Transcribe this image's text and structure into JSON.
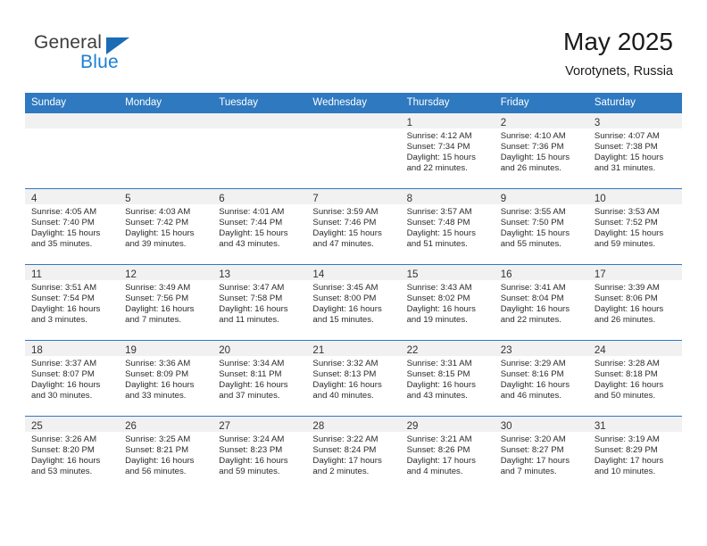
{
  "brand": {
    "line1": "General",
    "line2": "Blue",
    "triangle_color": "#1b6cb5",
    "blue_text_color": "#1b7fd4"
  },
  "header": {
    "title": "May 2025",
    "subtitle": "Vorotynets, Russia"
  },
  "theme": {
    "header_row_bg": "#2f79c0",
    "header_row_text": "#ffffff",
    "day_band_bg": "#f1f1f1",
    "row_divider": "#2f79c0"
  },
  "weekday_headers": [
    "Sunday",
    "Monday",
    "Tuesday",
    "Wednesday",
    "Thursday",
    "Friday",
    "Saturday"
  ],
  "labels": {
    "sunrise_prefix": "Sunrise:",
    "sunset_prefix": "Sunset:",
    "daylight_prefix": "Daylight:"
  },
  "weeks": [
    [
      {
        "day": "",
        "empty": true
      },
      {
        "day": "",
        "empty": true
      },
      {
        "day": "",
        "empty": true
      },
      {
        "day": "",
        "empty": true
      },
      {
        "day": "1",
        "sunrise": "Sunrise: 4:12 AM",
        "sunset": "Sunset: 7:34 PM",
        "daylight_line1": "Daylight: 15 hours",
        "daylight_line2": "and 22 minutes."
      },
      {
        "day": "2",
        "sunrise": "Sunrise: 4:10 AM",
        "sunset": "Sunset: 7:36 PM",
        "daylight_line1": "Daylight: 15 hours",
        "daylight_line2": "and 26 minutes."
      },
      {
        "day": "3",
        "sunrise": "Sunrise: 4:07 AM",
        "sunset": "Sunset: 7:38 PM",
        "daylight_line1": "Daylight: 15 hours",
        "daylight_line2": "and 31 minutes."
      }
    ],
    [
      {
        "day": "4",
        "sunrise": "Sunrise: 4:05 AM",
        "sunset": "Sunset: 7:40 PM",
        "daylight_line1": "Daylight: 15 hours",
        "daylight_line2": "and 35 minutes."
      },
      {
        "day": "5",
        "sunrise": "Sunrise: 4:03 AM",
        "sunset": "Sunset: 7:42 PM",
        "daylight_line1": "Daylight: 15 hours",
        "daylight_line2": "and 39 minutes."
      },
      {
        "day": "6",
        "sunrise": "Sunrise: 4:01 AM",
        "sunset": "Sunset: 7:44 PM",
        "daylight_line1": "Daylight: 15 hours",
        "daylight_line2": "and 43 minutes."
      },
      {
        "day": "7",
        "sunrise": "Sunrise: 3:59 AM",
        "sunset": "Sunset: 7:46 PM",
        "daylight_line1": "Daylight: 15 hours",
        "daylight_line2": "and 47 minutes."
      },
      {
        "day": "8",
        "sunrise": "Sunrise: 3:57 AM",
        "sunset": "Sunset: 7:48 PM",
        "daylight_line1": "Daylight: 15 hours",
        "daylight_line2": "and 51 minutes."
      },
      {
        "day": "9",
        "sunrise": "Sunrise: 3:55 AM",
        "sunset": "Sunset: 7:50 PM",
        "daylight_line1": "Daylight: 15 hours",
        "daylight_line2": "and 55 minutes."
      },
      {
        "day": "10",
        "sunrise": "Sunrise: 3:53 AM",
        "sunset": "Sunset: 7:52 PM",
        "daylight_line1": "Daylight: 15 hours",
        "daylight_line2": "and 59 minutes."
      }
    ],
    [
      {
        "day": "11",
        "sunrise": "Sunrise: 3:51 AM",
        "sunset": "Sunset: 7:54 PM",
        "daylight_line1": "Daylight: 16 hours",
        "daylight_line2": "and 3 minutes."
      },
      {
        "day": "12",
        "sunrise": "Sunrise: 3:49 AM",
        "sunset": "Sunset: 7:56 PM",
        "daylight_line1": "Daylight: 16 hours",
        "daylight_line2": "and 7 minutes."
      },
      {
        "day": "13",
        "sunrise": "Sunrise: 3:47 AM",
        "sunset": "Sunset: 7:58 PM",
        "daylight_line1": "Daylight: 16 hours",
        "daylight_line2": "and 11 minutes."
      },
      {
        "day": "14",
        "sunrise": "Sunrise: 3:45 AM",
        "sunset": "Sunset: 8:00 PM",
        "daylight_line1": "Daylight: 16 hours",
        "daylight_line2": "and 15 minutes."
      },
      {
        "day": "15",
        "sunrise": "Sunrise: 3:43 AM",
        "sunset": "Sunset: 8:02 PM",
        "daylight_line1": "Daylight: 16 hours",
        "daylight_line2": "and 19 minutes."
      },
      {
        "day": "16",
        "sunrise": "Sunrise: 3:41 AM",
        "sunset": "Sunset: 8:04 PM",
        "daylight_line1": "Daylight: 16 hours",
        "daylight_line2": "and 22 minutes."
      },
      {
        "day": "17",
        "sunrise": "Sunrise: 3:39 AM",
        "sunset": "Sunset: 8:06 PM",
        "daylight_line1": "Daylight: 16 hours",
        "daylight_line2": "and 26 minutes."
      }
    ],
    [
      {
        "day": "18",
        "sunrise": "Sunrise: 3:37 AM",
        "sunset": "Sunset: 8:07 PM",
        "daylight_line1": "Daylight: 16 hours",
        "daylight_line2": "and 30 minutes."
      },
      {
        "day": "19",
        "sunrise": "Sunrise: 3:36 AM",
        "sunset": "Sunset: 8:09 PM",
        "daylight_line1": "Daylight: 16 hours",
        "daylight_line2": "and 33 minutes."
      },
      {
        "day": "20",
        "sunrise": "Sunrise: 3:34 AM",
        "sunset": "Sunset: 8:11 PM",
        "daylight_line1": "Daylight: 16 hours",
        "daylight_line2": "and 37 minutes."
      },
      {
        "day": "21",
        "sunrise": "Sunrise: 3:32 AM",
        "sunset": "Sunset: 8:13 PM",
        "daylight_line1": "Daylight: 16 hours",
        "daylight_line2": "and 40 minutes."
      },
      {
        "day": "22",
        "sunrise": "Sunrise: 3:31 AM",
        "sunset": "Sunset: 8:15 PM",
        "daylight_line1": "Daylight: 16 hours",
        "daylight_line2": "and 43 minutes."
      },
      {
        "day": "23",
        "sunrise": "Sunrise: 3:29 AM",
        "sunset": "Sunset: 8:16 PM",
        "daylight_line1": "Daylight: 16 hours",
        "daylight_line2": "and 46 minutes."
      },
      {
        "day": "24",
        "sunrise": "Sunrise: 3:28 AM",
        "sunset": "Sunset: 8:18 PM",
        "daylight_line1": "Daylight: 16 hours",
        "daylight_line2": "and 50 minutes."
      }
    ],
    [
      {
        "day": "25",
        "sunrise": "Sunrise: 3:26 AM",
        "sunset": "Sunset: 8:20 PM",
        "daylight_line1": "Daylight: 16 hours",
        "daylight_line2": "and 53 minutes."
      },
      {
        "day": "26",
        "sunrise": "Sunrise: 3:25 AM",
        "sunset": "Sunset: 8:21 PM",
        "daylight_line1": "Daylight: 16 hours",
        "daylight_line2": "and 56 minutes."
      },
      {
        "day": "27",
        "sunrise": "Sunrise: 3:24 AM",
        "sunset": "Sunset: 8:23 PM",
        "daylight_line1": "Daylight: 16 hours",
        "daylight_line2": "and 59 minutes."
      },
      {
        "day": "28",
        "sunrise": "Sunrise: 3:22 AM",
        "sunset": "Sunset: 8:24 PM",
        "daylight_line1": "Daylight: 17 hours",
        "daylight_line2": "and 2 minutes."
      },
      {
        "day": "29",
        "sunrise": "Sunrise: 3:21 AM",
        "sunset": "Sunset: 8:26 PM",
        "daylight_line1": "Daylight: 17 hours",
        "daylight_line2": "and 4 minutes."
      },
      {
        "day": "30",
        "sunrise": "Sunrise: 3:20 AM",
        "sunset": "Sunset: 8:27 PM",
        "daylight_line1": "Daylight: 17 hours",
        "daylight_line2": "and 7 minutes."
      },
      {
        "day": "31",
        "sunrise": "Sunrise: 3:19 AM",
        "sunset": "Sunset: 8:29 PM",
        "daylight_line1": "Daylight: 17 hours",
        "daylight_line2": "and 10 minutes."
      }
    ]
  ]
}
